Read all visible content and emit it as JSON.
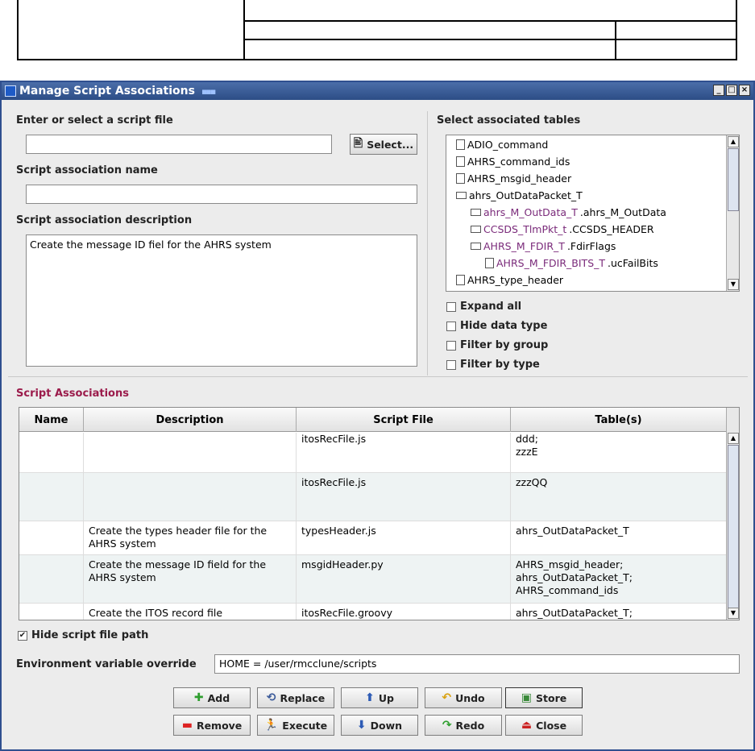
{
  "window": {
    "title": "Manage Script Associations",
    "controls": [
      "_",
      "□",
      "×"
    ]
  },
  "left": {
    "script_file_label": "Enter or select a script file",
    "script_file_value": "",
    "select_button": "Select...",
    "assoc_name_label": "Script association name",
    "assoc_name_value": "",
    "assoc_desc_label": "Script association description",
    "assoc_desc_value": "Create the message ID fiel for the AHRS system"
  },
  "right": {
    "tables_label": "Select associated tables",
    "tree": [
      {
        "text": "ADIO_command",
        "suffix": "",
        "kind": "file",
        "depth": 0,
        "purple": false
      },
      {
        "text": "AHRS_command_ids",
        "suffix": "",
        "kind": "file",
        "depth": 0,
        "purple": false
      },
      {
        "text": "AHRS_msgid_header",
        "suffix": "",
        "kind": "file",
        "depth": 0,
        "purple": false
      },
      {
        "text": "ahrs_OutDataPacket_T",
        "suffix": "",
        "kind": "folder",
        "depth": 0,
        "purple": false
      },
      {
        "text": "ahrs_M_OutData_T",
        "suffix": ".ahrs_M_OutData",
        "kind": "folder",
        "depth": 1,
        "purple": true
      },
      {
        "text": "CCSDS_TlmPkt_t",
        "suffix": ".CCSDS_HEADER",
        "kind": "folder",
        "depth": 1,
        "purple": true
      },
      {
        "text": "AHRS_M_FDIR_T",
        "suffix": ".FdirFlags",
        "kind": "folder",
        "depth": 1,
        "purple": true
      },
      {
        "text": "AHRS_M_FDIR_BITS_T",
        "suffix": ".ucFailBits",
        "kind": "file",
        "depth": 2,
        "purple": true
      },
      {
        "text": "AHRS_type_header",
        "suffix": "",
        "kind": "file",
        "depth": 0,
        "purple": false
      }
    ],
    "checkboxes": [
      {
        "label": "Expand all",
        "checked": false
      },
      {
        "label": "Hide data type",
        "checked": false
      },
      {
        "label": "Filter by group",
        "checked": false
      },
      {
        "label": "Filter by type",
        "checked": false
      }
    ]
  },
  "assoc": {
    "section_label": "Script Associations",
    "columns": [
      "Name",
      "Description",
      "Script File",
      "Table(s)"
    ],
    "rows": [
      {
        "name": "",
        "description": "",
        "script": "itosRecFile.js",
        "tables": "ddd;\nzzzE"
      },
      {
        "name": "",
        "description": "",
        "script": "itosRecFile.js",
        "tables": "zzzQQ"
      },
      {
        "name": "",
        "description": "Create the types header file for the AHRS system",
        "script": "typesHeader.js",
        "tables": "ahrs_OutDataPacket_T"
      },
      {
        "name": "",
        "description": "Create the message ID field for the AHRS system",
        "script": "msgidHeader.py",
        "tables": "AHRS_msgid_header;\nahrs_OutDataPacket_T;\nAHRS_command_ids"
      },
      {
        "name": "",
        "description": "Create the ITOS record file",
        "script": "itosRecFile.groovy",
        "tables": "ahrs_OutDataPacket_T;"
      }
    ]
  },
  "hide_path": {
    "label": "Hide script file path",
    "checked": true
  },
  "env": {
    "label": "Environment variable override",
    "value": "HOME = /user/rmcclune/scripts"
  },
  "buttons": {
    "add": "Add",
    "replace": "Replace",
    "up": "Up",
    "undo": "Undo",
    "store": "Store",
    "remove": "Remove",
    "execute": "Execute",
    "down": "Down",
    "redo": "Redo",
    "close": "Close"
  },
  "colors": {
    "title_bar": "#2c4d86",
    "section_accent": "#9b1b4b",
    "tree_purple": "#7a2a7a"
  }
}
